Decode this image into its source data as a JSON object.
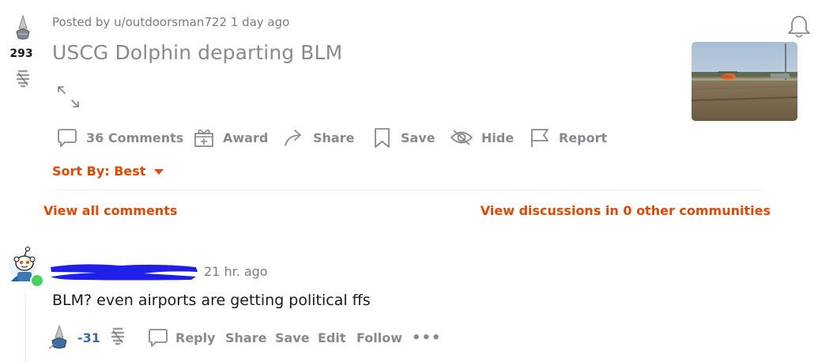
{
  "post": {
    "score": "293",
    "meta": "Posted by u/outdoorsman722 1 day ago",
    "title": "USCG Dolphin departing BLM",
    "actions": {
      "comments": "36 Comments",
      "award": "Award",
      "share": "Share",
      "save": "Save",
      "hide": "Hide",
      "report": "Report"
    },
    "sort_label": "Sort By: Best"
  },
  "links": {
    "view_all": "View all comments",
    "view_discussions": "View discussions in 0 other communities"
  },
  "comment": {
    "time": "21 hr. ago",
    "body": "BLM? even airports are getting political ffs",
    "score": "-31",
    "actions": {
      "reply": "Reply",
      "share": "Share",
      "save": "Save",
      "edit": "Edit",
      "follow": "Follow",
      "more": "•••"
    }
  },
  "icons": {
    "upvote": "upvote-arrow-icon",
    "downvote": "downvote-arrow-icon",
    "bell": "bell-icon",
    "expand": "expand-icon",
    "comment": "comment-bubble-icon",
    "award": "gift-icon",
    "share": "share-arrow-icon",
    "save": "bookmark-icon",
    "hide": "eye-slash-icon",
    "report": "flag-icon",
    "caret": "caret-down-icon",
    "online": "online-dot-icon"
  },
  "colors": {
    "accent": "#e44700",
    "muted": "#878a8c",
    "comment_score": "#3d6e9f",
    "online_dot": "#46d160",
    "redaction": "#1f1fe8"
  }
}
